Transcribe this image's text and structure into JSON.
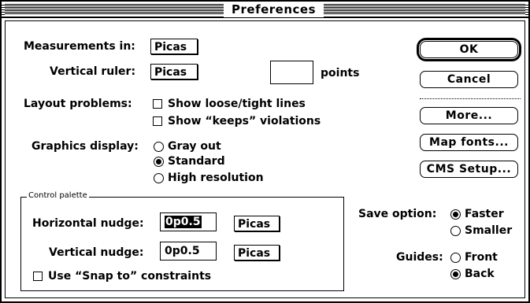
{
  "window": {
    "title": "Preferences"
  },
  "measurements": {
    "label": "Measurements in:",
    "value": "Picas"
  },
  "vertical_ruler": {
    "label": "Vertical ruler:",
    "value": "Picas",
    "points_value": "",
    "points_label": "points"
  },
  "layout_problems": {
    "label": "Layout problems:",
    "options": [
      {
        "label": "Show loose/tight lines",
        "checked": false
      },
      {
        "label": "Show “keeps” violations",
        "checked": false
      }
    ]
  },
  "graphics_display": {
    "label": "Graphics display:",
    "options": [
      {
        "label": "Gray out",
        "selected": false
      },
      {
        "label": "Standard",
        "selected": true
      },
      {
        "label": "High resolution",
        "selected": false
      }
    ]
  },
  "control_palette": {
    "group_label": "Control palette",
    "horizontal_nudge": {
      "label": "Horizontal nudge:",
      "value": "0p0.5",
      "unit": "Picas"
    },
    "vertical_nudge": {
      "label": "Vertical nudge:",
      "value": "0p0.5",
      "unit": "Picas"
    },
    "snap_to": {
      "label": "Use “Snap to” constraints",
      "checked": false
    }
  },
  "save_option": {
    "label": "Save option:",
    "options": [
      {
        "label": "Faster",
        "selected": true
      },
      {
        "label": "Smaller",
        "selected": false
      }
    ]
  },
  "guides": {
    "label": "Guides:",
    "options": [
      {
        "label": "Front",
        "selected": false
      },
      {
        "label": "Back",
        "selected": true
      }
    ]
  },
  "buttons": {
    "ok": "OK",
    "cancel": "Cancel",
    "more": "More...",
    "map_fonts": "Map fonts...",
    "cms_setup": "CMS Setup..."
  }
}
